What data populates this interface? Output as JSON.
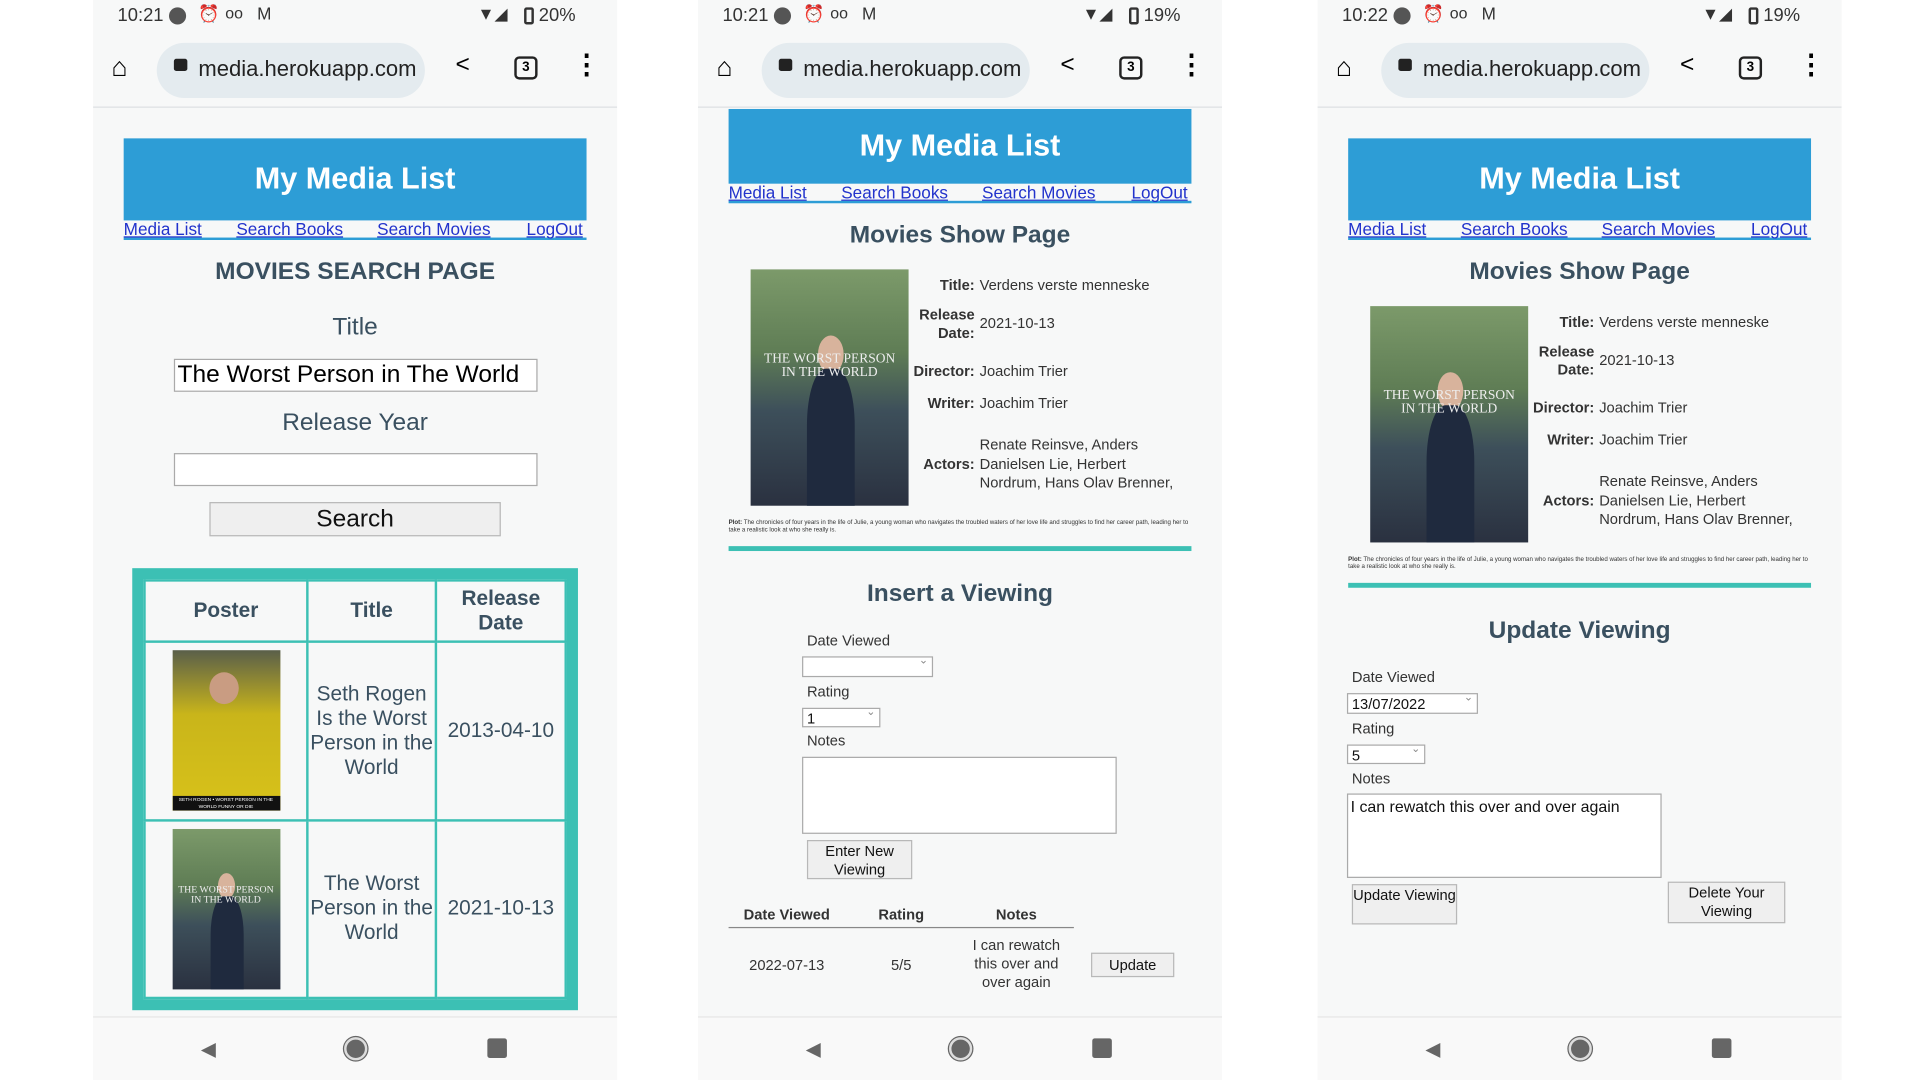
{
  "phones": [
    {
      "status": {
        "time": "10:21",
        "battery": "20%"
      },
      "url": "media.herokuapp.com",
      "tabs_count": "3"
    },
    {
      "status": {
        "time": "10:21",
        "battery": "19%"
      },
      "url": "media.herokuapp.com",
      "tabs_count": "3"
    },
    {
      "status": {
        "time": "10:22",
        "battery": "19%"
      },
      "url": "media.herokuapp.com",
      "tabs_count": "3"
    }
  ],
  "site": {
    "title": "My Media List",
    "nav": [
      "Media List",
      "Search Books",
      "Search Movies",
      "LogOut"
    ]
  },
  "search": {
    "heading": "MOVIES SEARCH PAGE",
    "title_label": "Title",
    "title_value": "The Worst Person in The World",
    "year_label": "Release Year",
    "year_value": "",
    "button": "Search",
    "columns": [
      "Poster",
      "Title",
      "Release Date"
    ],
    "rows": [
      {
        "title": "Seth Rogen Is the Worst Person in the World",
        "date": "2013-04-10",
        "poster_text": "SETH ROGEN • WORST PERSON IN THE WORLD FUNNY OR DIE"
      },
      {
        "title": "The Worst Person in the World",
        "date": "2021-10-13",
        "poster_text": "THE WORST PERSON IN THE WORLD"
      }
    ]
  },
  "show": {
    "heading": "Movies Show Page",
    "poster_text": "THE WORST PERSON IN THE WORLD",
    "labels": {
      "title": "Title:",
      "release": "Release Date:",
      "director": "Director:",
      "writer": "Writer:",
      "actors": "Actors:",
      "plot": "Plot:"
    },
    "title": "Verdens verste menneske",
    "release": "2021-10-13",
    "director": "Joachim Trier",
    "writer": "Joachim Trier",
    "actors": "Renate Reinsve, Anders Danielsen Lie, Herbert Nordrum, Hans Olav Brenner,",
    "plot": "The chronicles of four years in the life of Julie, a young woman who navigates the troubled waters of her love life and struggles to find her career path, leading her to take a realistic look at who she really is."
  },
  "insert": {
    "heading": "Insert a Viewing",
    "date_label": "Date Viewed",
    "date_value": "",
    "rating_label": "Rating",
    "rating_value": "1",
    "notes_label": "Notes",
    "notes_value": "",
    "button": "Enter New Viewing",
    "columns": [
      "Date Viewed",
      "Rating",
      "Notes"
    ],
    "row": {
      "date": "2022-07-13",
      "rating": "5/5",
      "notes": "I can rewatch this over and over again",
      "button": "Update"
    }
  },
  "update": {
    "heading": "Update Viewing",
    "date_label": "Date Viewed",
    "date_value": "13/07/2022",
    "rating_label": "Rating",
    "rating_value": "5",
    "notes_label": "Notes",
    "notes_value": "I can rewatch this over and over again",
    "update_button": "Update Viewing",
    "delete_button": "Delete Your Viewing"
  },
  "colors": {
    "header": "#2d9dd6",
    "teal": "#3cc0b4",
    "text": "#3a5060",
    "link": "#2233cc"
  }
}
